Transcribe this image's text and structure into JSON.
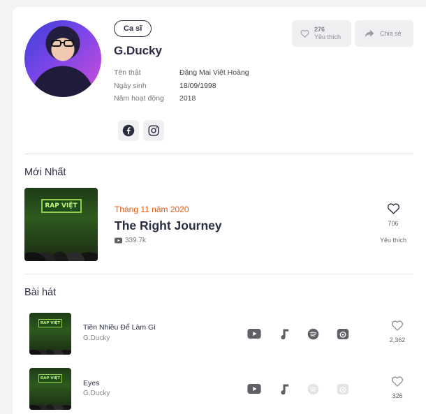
{
  "artist": {
    "role_badge": "Ca sĩ",
    "name": "G.Ducky",
    "info": [
      {
        "label": "Tên thật",
        "value": "Đặng Mai Việt Hoàng"
      },
      {
        "label": "Ngày sinh",
        "value": "18/09/1998"
      },
      {
        "label": "Năm hoạt động",
        "value": "2018"
      }
    ],
    "social": [
      "facebook-icon",
      "instagram-icon"
    ]
  },
  "actions": {
    "like_count": "276",
    "like_label": "Yêu thích",
    "share_label": "Chia sẻ"
  },
  "latest": {
    "section_title": "Mới Nhất",
    "cover_logo": "RAP VIỆT",
    "date": "Tháng 11 năm 2020",
    "title": "The Right Journey",
    "views": "339.7k",
    "like_count": "706",
    "like_label": "Yêu thích"
  },
  "songs": {
    "section_title": "Bài hát",
    "items": [
      {
        "title": "Tiền Nhiều Để Làm Gì",
        "artist": "G.Ducky",
        "likes": "2,362",
        "cover_logo": "RAP VIỆT",
        "services": {
          "youtube": true,
          "music": true,
          "spotify": true,
          "podcast": true
        }
      },
      {
        "title": "Eyes",
        "artist": "G.Ducky",
        "likes": "326",
        "cover_logo": "RAP VIỆT",
        "services": {
          "youtube": true,
          "music": true,
          "spotify": false,
          "podcast": false
        }
      }
    ]
  },
  "colors": {
    "accent": "#e8590c",
    "text": "#2b2d42",
    "icon_active": "#5f5f66",
    "icon_inactive": "#cfcfd4"
  }
}
